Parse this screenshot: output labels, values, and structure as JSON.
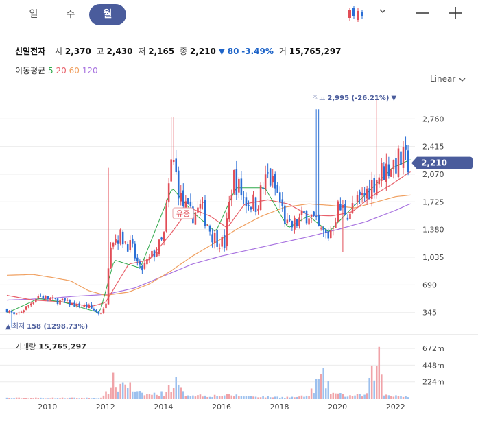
{
  "tabs": [
    {
      "label": "일",
      "active": false
    },
    {
      "label": "주",
      "active": false
    },
    {
      "label": "월",
      "active": true
    }
  ],
  "toolbar": {
    "chart_type_icon": "candlestick-icon",
    "dropdown_icon": "chevron-down-icon",
    "zoom_out_icon": "minus-icon",
    "zoom_in_icon": "plus-icon"
  },
  "stock": {
    "name": "신일전자",
    "open_label": "시",
    "open": "2,370",
    "high_label": "고",
    "high": "2,430",
    "low_label": "저",
    "low": "2,165",
    "close_label": "종",
    "close": "2,210",
    "change_arrow": "▼",
    "change": "80",
    "change_pct": "-3.49%",
    "volume_label": "거",
    "volume": "15,765,297"
  },
  "moving_average": {
    "label": "이동평균",
    "periods": [
      {
        "value": "5",
        "color": "#2ea84a"
      },
      {
        "value": "20",
        "color": "#e8606a"
      },
      {
        "value": "60",
        "color": "#f0a060"
      },
      {
        "value": "120",
        "color": "#a873e0"
      }
    ]
  },
  "scale_toggle": {
    "label": "Linear",
    "icon": "chevron-down-icon"
  },
  "colors": {
    "up": "#e14d57",
    "down": "#2b6fd6",
    "accent": "#4a5c9c",
    "ma5": "#2ea84a",
    "ma20": "#e8606a",
    "ma60": "#f0a060",
    "ma120": "#a873e0"
  },
  "chart_data": {
    "type": "candlestick",
    "scale": "linear",
    "interval": "monthly",
    "y_ticks": [
      "2,760",
      "2,415",
      "2,070",
      "1,725",
      "1,380",
      "1,035",
      "690",
      "345"
    ],
    "y_tick_values": [
      2760,
      2415,
      2070,
      1725,
      1380,
      1035,
      690,
      345
    ],
    "ylim": [
      120,
      3130
    ],
    "x_ticks": [
      "2010",
      "2012",
      "2014",
      "2016",
      "2018",
      "2020",
      "2022"
    ],
    "x_tick_years": [
      2010,
      2012,
      2014,
      2016,
      2018,
      2020,
      2022
    ],
    "xlim": [
      2008.6,
      2022.55
    ],
    "current_price": {
      "label": "2,210",
      "value": 2210
    },
    "high_marker": {
      "label": "최고",
      "value_text": "2,995 (-26.21%)",
      "arrow": "▼",
      "value": 2995,
      "year": 2021.38
    },
    "low_marker": {
      "label": "최저",
      "value_text": "158 (1298.73%)",
      "arrow": "▲",
      "value": 158,
      "year": 2008.75
    },
    "annotation": {
      "label": "유증",
      "value": 1480,
      "year": 2014.5
    },
    "volume_panel": {
      "title": "거래량",
      "value": "15,765,297",
      "y_ticks": [
        "672m",
        "448m",
        "224m"
      ],
      "y_tick_values": [
        672,
        448,
        224
      ],
      "ylim": [
        0,
        820
      ]
    },
    "price_anchors": [
      [
        2008.6,
        380
      ],
      [
        2008.9,
        300
      ],
      [
        2009.3,
        420
      ],
      [
        2009.7,
        560
      ],
      [
        2010.2,
        500
      ],
      [
        2010.6,
        480
      ],
      [
        2011.0,
        430
      ],
      [
        2011.4,
        420
      ],
      [
        2011.8,
        330
      ],
      [
        2012.0,
        400
      ],
      [
        2012.15,
        1250
      ],
      [
        2012.5,
        1300
      ],
      [
        2012.9,
        1150
      ],
      [
        2013.2,
        860
      ],
      [
        2013.6,
        1050
      ],
      [
        2014.0,
        1250
      ],
      [
        2014.3,
        2300
      ],
      [
        2014.6,
        1750
      ],
      [
        2014.9,
        1550
      ],
      [
        2015.3,
        1650
      ],
      [
        2015.7,
        1300
      ],
      [
        2016.1,
        1200
      ],
      [
        2016.4,
        2050
      ],
      [
        2016.8,
        1750
      ],
      [
        2017.2,
        1700
      ],
      [
        2017.6,
        2050
      ],
      [
        2017.9,
        1850
      ],
      [
        2018.3,
        1380
      ],
      [
        2018.7,
        1500
      ],
      [
        2019.0,
        1600
      ],
      [
        2019.4,
        1350
      ],
      [
        2019.7,
        1300
      ],
      [
        2020.0,
        1650
      ],
      [
        2020.4,
        1600
      ],
      [
        2020.8,
        1750
      ],
      [
        2021.1,
        1900
      ],
      [
        2021.5,
        2100
      ],
      [
        2021.9,
        2200
      ],
      [
        2022.2,
        2250
      ],
      [
        2022.5,
        2210
      ]
    ],
    "ma_anchors": {
      "ma5": [
        [
          2008.6,
          340
        ],
        [
          2009.7,
          520
        ],
        [
          2010.6,
          470
        ],
        [
          2011.8,
          340
        ],
        [
          2012.3,
          1000
        ],
        [
          2013.2,
          900
        ],
        [
          2014.3,
          1900
        ],
        [
          2015.0,
          1600
        ],
        [
          2015.8,
          1350
        ],
        [
          2016.5,
          1900
        ],
        [
          2017.5,
          1900
        ],
        [
          2018.3,
          1400
        ],
        [
          2019.0,
          1550
        ],
        [
          2019.7,
          1350
        ],
        [
          2020.5,
          1650
        ],
        [
          2021.2,
          1900
        ],
        [
          2021.9,
          2150
        ],
        [
          2022.5,
          2250
        ]
      ],
      "ma20": [
        [
          2008.6,
          560
        ],
        [
          2009.5,
          500
        ],
        [
          2010.5,
          480
        ],
        [
          2011.5,
          420
        ],
        [
          2012.0,
          470
        ],
        [
          2012.8,
          950
        ],
        [
          2013.5,
          1000
        ],
        [
          2014.3,
          1350
        ],
        [
          2014.9,
          1650
        ],
        [
          2015.6,
          1550
        ],
        [
          2016.2,
          1400
        ],
        [
          2016.8,
          1700
        ],
        [
          2017.6,
          1750
        ],
        [
          2018.3,
          1700
        ],
        [
          2019.0,
          1560
        ],
        [
          2019.8,
          1550
        ],
        [
          2020.5,
          1600
        ],
        [
          2021.2,
          1800
        ],
        [
          2021.9,
          1950
        ],
        [
          2022.5,
          2100
        ]
      ],
      "ma60": [
        [
          2008.6,
          810
        ],
        [
          2009.5,
          820
        ],
        [
          2010.2,
          780
        ],
        [
          2010.8,
          740
        ],
        [
          2011.4,
          620
        ],
        [
          2012.0,
          560
        ],
        [
          2012.8,
          600
        ],
        [
          2013.5,
          700
        ],
        [
          2014.2,
          850
        ],
        [
          2015.0,
          1050
        ],
        [
          2015.8,
          1220
        ],
        [
          2016.6,
          1400
        ],
        [
          2017.4,
          1550
        ],
        [
          2018.2,
          1660
        ],
        [
          2019.0,
          1700
        ],
        [
          2019.8,
          1680
        ],
        [
          2020.6,
          1650
        ],
        [
          2021.3,
          1720
        ],
        [
          2022.0,
          1790
        ],
        [
          2022.5,
          1810
        ]
      ],
      "ma120": [
        [
          2008.6,
          500
        ],
        [
          2010.0,
          520
        ],
        [
          2011.0,
          550
        ],
        [
          2012.0,
          570
        ],
        [
          2013.0,
          650
        ],
        [
          2014.0,
          800
        ],
        [
          2015.0,
          950
        ],
        [
          2016.0,
          1050
        ],
        [
          2017.0,
          1130
        ],
        [
          2018.0,
          1210
        ],
        [
          2019.0,
          1290
        ],
        [
          2020.0,
          1380
        ],
        [
          2021.0,
          1480
        ],
        [
          2022.0,
          1620
        ],
        [
          2022.5,
          1700
        ]
      ]
    },
    "volume_anchors": [
      [
        2008.6,
        10
      ],
      [
        2011.9,
        10
      ],
      [
        2012.1,
        130
      ],
      [
        2012.2,
        320
      ],
      [
        2012.4,
        160
      ],
      [
        2012.7,
        280
      ],
      [
        2013.0,
        90
      ],
      [
        2013.5,
        60
      ],
      [
        2014.0,
        80
      ],
      [
        2014.2,
        170
      ],
      [
        2014.4,
        260
      ],
      [
        2014.7,
        70
      ],
      [
        2015.5,
        40
      ],
      [
        2016.3,
        50
      ],
      [
        2017.5,
        25
      ],
      [
        2018.5,
        20
      ],
      [
        2019.0,
        40
      ],
      [
        2019.3,
        250
      ],
      [
        2019.5,
        330
      ],
      [
        2019.8,
        90
      ],
      [
        2020.3,
        40
      ],
      [
        2021.0,
        50
      ],
      [
        2021.4,
        730
      ],
      [
        2021.6,
        60
      ],
      [
        2022.5,
        30
      ]
    ]
  }
}
